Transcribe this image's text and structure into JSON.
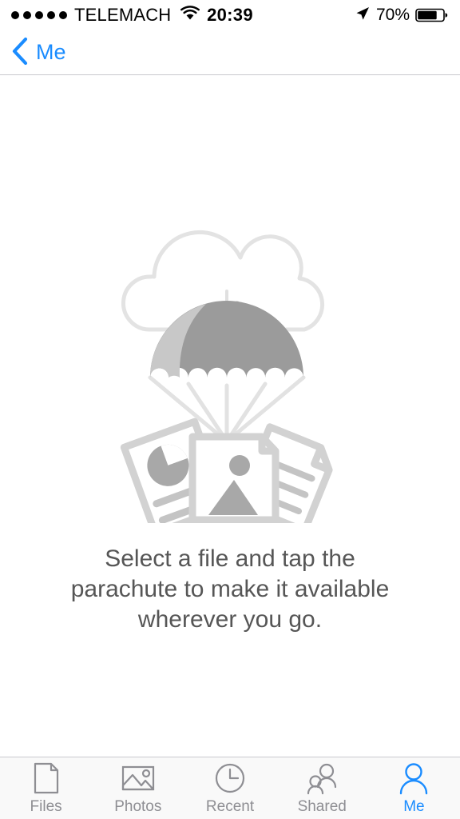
{
  "status_bar": {
    "signal_dots": 5,
    "carrier": "TELEMACH",
    "wifi_icon": "wifi-icon",
    "time": "20:39",
    "location_icon": "location-arrow-icon",
    "battery_percent": "70%",
    "battery_level": 70,
    "battery_icon": "battery-icon"
  },
  "nav_bar": {
    "back_icon": "chevron-left-icon",
    "back_label": "Me",
    "accent_color": "#1a8cff"
  },
  "empty_state": {
    "illustration_name": "parachute-documents-cloud-illustration",
    "message": "Select a file and tap the parachute to make it available wherever you go.",
    "cloud_color": "#e3e3e3",
    "canopy_dark_color": "#9b9b9b",
    "canopy_light_color": "#c8c8c8",
    "document_color": "#d2d2d2",
    "document_accent_color": "#a8a8a8",
    "text_color": "#565656"
  },
  "tab_bar": {
    "active_index": 4,
    "inactive_color": "#8e8e93",
    "active_color": "#1a8cff",
    "tabs": [
      {
        "label": "Files",
        "icon": "document-icon"
      },
      {
        "label": "Photos",
        "icon": "photo-icon"
      },
      {
        "label": "Recent",
        "icon": "clock-icon"
      },
      {
        "label": "Shared",
        "icon": "people-icon"
      },
      {
        "label": "Me",
        "icon": "person-icon"
      }
    ]
  }
}
